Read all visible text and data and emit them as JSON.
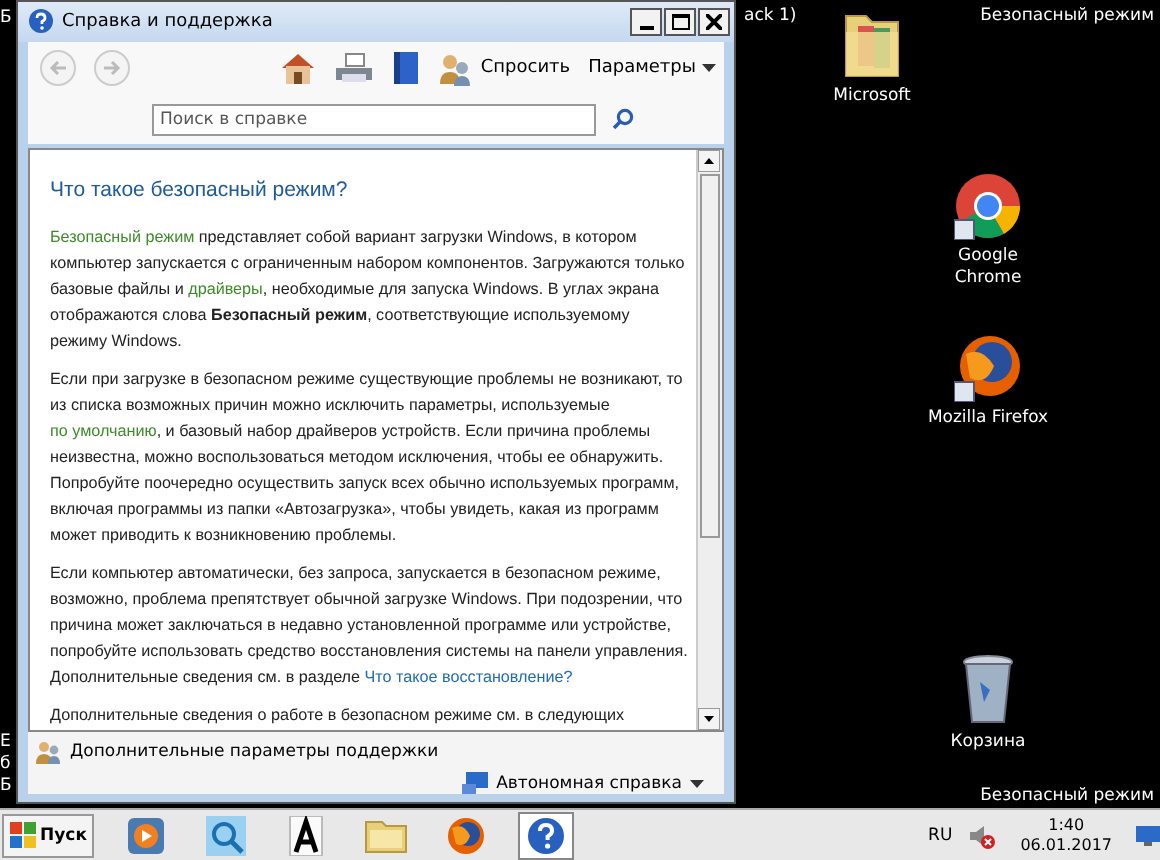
{
  "desktop": {
    "left_edge_top": "Б",
    "left_edge_bottom": [
      "Е",
      "б",
      "Б"
    ],
    "title_fragment": "ack 1)",
    "corner_label_top": "Безопасный режим",
    "corner_label_bottom": "Безопасный режим",
    "icons": [
      {
        "label": "Microsoft",
        "kind": "folder"
      },
      {
        "label": "Google Chrome",
        "kind": "chrome"
      },
      {
        "label": "Mozilla Firefox",
        "kind": "firefox"
      },
      {
        "label": "Корзина",
        "kind": "bin"
      }
    ]
  },
  "window": {
    "title": "Справка и поддержка",
    "toolbar": {
      "back_disabled": true,
      "forward_disabled": true,
      "ask": "Спросить",
      "options": "Параметры"
    },
    "search": {
      "placeholder": "Поиск в справке"
    },
    "heading": "Что такое безопасный режим?",
    "paragraphs": [
      [
        {
          "kind": "link",
          "text": "Безопасный режим"
        },
        {
          "kind": "plain",
          "text": " представляет собой вариант загрузки Windows, в котором компьютер запускается с ограниченным набором компонентов. Загружаются только базовые файлы и "
        },
        {
          "kind": "link",
          "text": "драйверы"
        },
        {
          "kind": "plain",
          "text": ", необходимые для запуска Windows. В углах экрана отображаются слова "
        },
        {
          "kind": "bold",
          "text": "Безопасный режим"
        },
        {
          "kind": "plain",
          "text": ", соответствующие используемому режиму Windows."
        }
      ],
      [
        {
          "kind": "plain",
          "text": "Если при загрузке в безопасном режиме существующие проблемы не возникают, то из списка возможных причин можно исключить параметры, используемые "
        },
        {
          "kind": "link",
          "text": "по умолчанию"
        },
        {
          "kind": "plain",
          "text": ", и базовый набор драйверов устройств. Если причина проблемы неизвестна, можно воспользоваться методом исключения, чтобы ее обнаружить. Попробуйте поочередно осуществить запуск всех обычно используемых программ, включая программы из папки «Автозагрузка», чтобы увидеть, какая из программ может приводить к возникновению проблемы."
        }
      ],
      [
        {
          "kind": "plain",
          "text": "Если компьютер автоматически, без запроса, запускается в безопасном режиме, возможно, проблема препятствует обычной загрузке Windows. При подозрении, что причина может заключаться в недавно установленной программе или устройстве, попробуйте использовать средство восстановления системы на панели управления. Дополнительные сведения см. в разделе "
        },
        {
          "kind": "xref",
          "text": "Что такое восстановление?"
        }
      ],
      [
        {
          "kind": "plain",
          "text": "Дополнительные сведения о работе в безопасном режиме см. в следующих"
        }
      ]
    ],
    "footer": {
      "support": "Дополнительные параметры поддержки",
      "offline": "Автономная справка"
    }
  },
  "taskbar": {
    "start": "Пуск",
    "apps": [
      {
        "kind": "media",
        "selected": false
      },
      {
        "kind": "search",
        "selected": false
      },
      {
        "kind": "font",
        "selected": false
      },
      {
        "kind": "folder",
        "selected": false
      },
      {
        "kind": "firefox",
        "selected": false
      },
      {
        "kind": "help",
        "selected": true
      }
    ],
    "language": "RU",
    "time": "1:40",
    "date": "06.01.2017"
  }
}
